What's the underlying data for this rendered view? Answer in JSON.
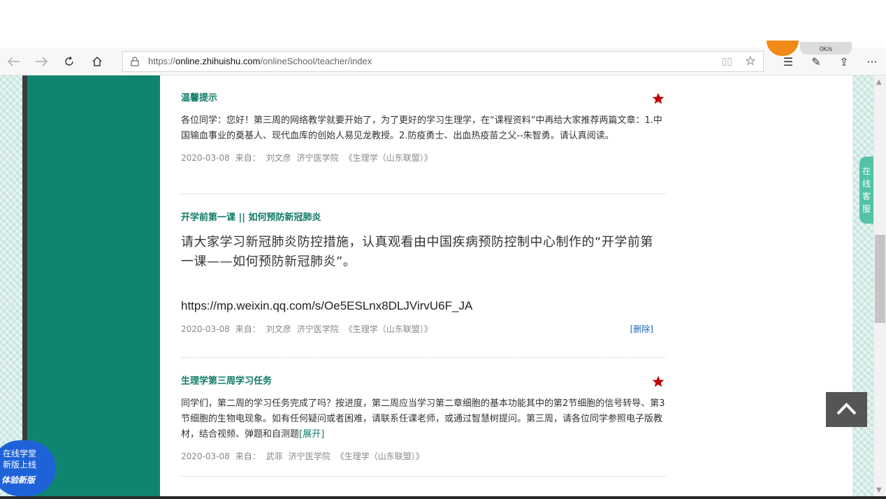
{
  "browser": {
    "url_prefix": "https://",
    "url_domain": "online.zhihuishu.com",
    "url_path": "/onlineSchool/teacher/index",
    "extension_text": "0K/s"
  },
  "service": {
    "label_chars": [
      "在",
      "线",
      "客",
      "服"
    ]
  },
  "badge": {
    "line1": "在线学堂",
    "line2": "新版上线",
    "line3": "体验新版"
  },
  "posts": [
    {
      "title": "温馨提示",
      "pinned": true,
      "body": "各位同学：您好！第三周的网络教学就要开始了，为了更好的学习生理学，在“课程资料”中再给大家推荐两篇文章：1.中国输血事业的奠基人、现代血库的创始人易见龙教授。2.防疫勇士、出血热疫苗之父--朱智勇。请认真阅读。",
      "date": "2020-03-08",
      "from_label": "来自：",
      "author": "刘文彦",
      "school": "济宁医学院",
      "course": "《生理学（山东联盟）》"
    },
    {
      "title": "开学前第一课 || 如何预防新冠肺炎",
      "pinned": false,
      "body": "请大家学习新冠肺炎防控措施，认真观看由中国疾病预防控制中心制作的“开学前第一课——如何预防新冠肺炎”。",
      "link": "https://mp.weixin.qq.com/s/Oe5ESLnx8DLJVirvU6F_JA",
      "date": "2020-03-08",
      "from_label": "来自：",
      "author": "刘文彦",
      "school": "济宁医学院",
      "course": "《生理学（山东联盟）》",
      "delete_label": "[删除]"
    },
    {
      "title": "生理学第三周学习任务",
      "pinned": true,
      "body": "同学们，第二周的学习任务完成了吗？按进度，第二周应当学习第二章细胞的基本功能其中的第2节细胞的信号转导、第3节细胞的生物电现象。如有任何疑问或者困难，请联系任课老师，或通过智慧树提问。第三周，请各位同学参照电子版教材，结合视频、弹题和自测题",
      "expand_label": "[展开]",
      "date": "2020-03-08",
      "from_label": "来自：",
      "author": "武菲",
      "school": "济宁医学院",
      "course": "《生理学（山东联盟）》"
    }
  ],
  "colors": {
    "accent": "#0f7a66",
    "sidebar": "#0f8570",
    "pin": "#c00000",
    "link": "#1a66b3"
  }
}
